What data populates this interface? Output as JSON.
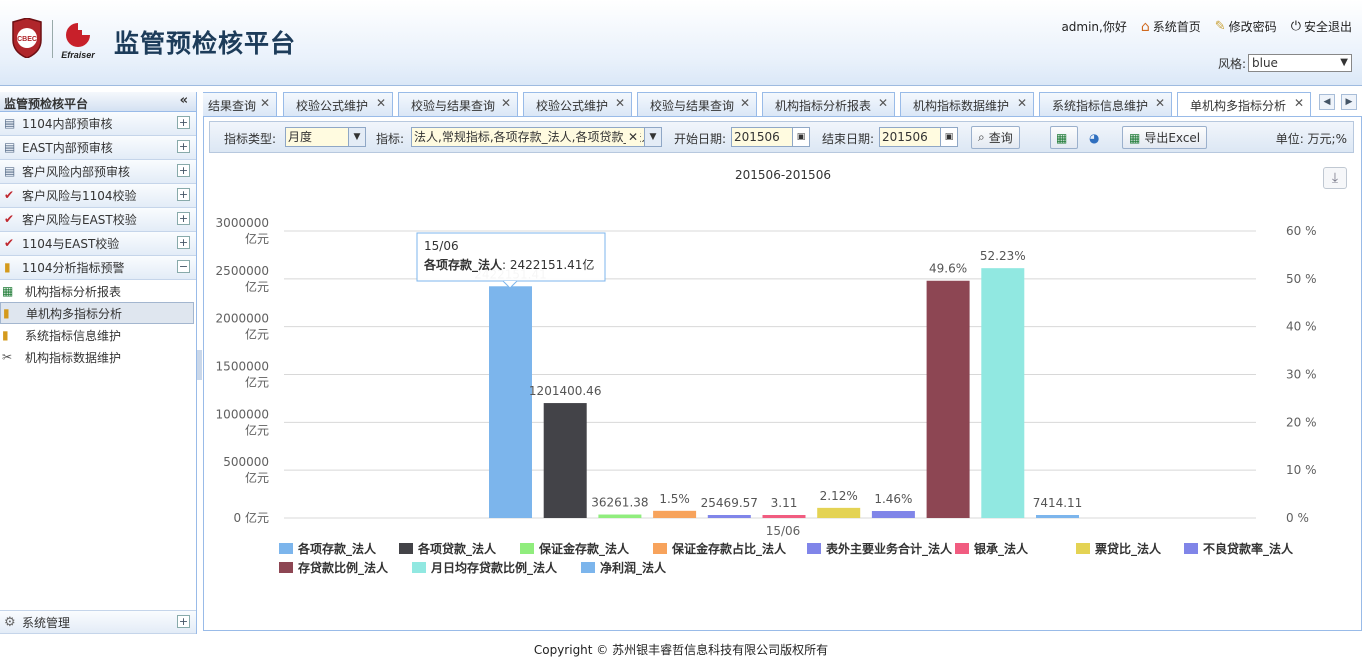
{
  "app": {
    "title": "监管预检核平台",
    "logo1": "CBEC",
    "logo2": "Efraiser"
  },
  "userbar": {
    "greeting": "admin,你好",
    "home": "系统首页",
    "password": "修改密码",
    "logout": "安全退出",
    "style_label": "风格:",
    "style_value": "blue"
  },
  "sidebar": {
    "title": "监管预检核平台",
    "groups": [
      {
        "label": "1104内部预审核",
        "icon": "form-icon"
      },
      {
        "label": "EAST内部预审核",
        "icon": "form-icon"
      },
      {
        "label": "客户风险内部预审核",
        "icon": "form-icon"
      },
      {
        "label": "客户风险与1104校验",
        "icon": "check-icon"
      },
      {
        "label": "客户风险与EAST校验",
        "icon": "check-icon"
      },
      {
        "label": "1104与EAST校验",
        "icon": "check-icon"
      },
      {
        "label": "1104分析指标预警",
        "icon": "bar-chart-icon"
      }
    ],
    "items": [
      {
        "label": "机构指标分析报表",
        "icon": "excel-icon"
      },
      {
        "label": "单机构多指标分析",
        "icon": "bar-chart-icon"
      },
      {
        "label": "系统指标信息维护",
        "icon": "bar-chart-icon"
      },
      {
        "label": "机构指标数据维护",
        "icon": "tools-icon"
      }
    ],
    "system": "系统管理"
  },
  "tabs": [
    "结果查询",
    "校验公式维护",
    "校验与结果查询",
    "校验公式维护",
    "校验与结果查询",
    "机构指标分析报表",
    "机构指标数据维护",
    "系统指标信息维护",
    "单机构多指标分析"
  ],
  "toolbar": {
    "type_label": "指标类型:",
    "type_value": "月度",
    "index_label": "指标:",
    "index_value": "法人,常规指标,各项存款_法人,各项贷款_法人",
    "start_label": "开始日期:",
    "start_value": "201506",
    "end_label": "结束日期:",
    "end_value": "201506",
    "query": "查询",
    "export": "导出Excel",
    "unit": "单位: 万元;%"
  },
  "tooltip": {
    "x": "15/06",
    "series": "各项存款_法人",
    "value": "2422151.41亿"
  },
  "chart_data": {
    "type": "bar",
    "title": "201506-201506",
    "categories": [
      "15/06"
    ],
    "y_left": {
      "min": 0,
      "max": 3000000,
      "ticks": [
        "0 亿元",
        "500000\n亿元",
        "1000000\n亿元",
        "1500000\n亿元",
        "2000000\n亿元",
        "2500000\n亿元",
        "3000000\n亿元"
      ]
    },
    "y_right": {
      "min": 0,
      "max": 60,
      "ticks": [
        "0 %",
        "10 %",
        "20 %",
        "30 %",
        "40 %",
        "50 %",
        "60 %"
      ]
    },
    "grid": true,
    "legend": "bottom-left",
    "series": [
      {
        "name": "各项存款_法人",
        "value": 2422151.41,
        "label": "2422151.41",
        "axis": "left",
        "color": "#7cb5ec"
      },
      {
        "name": "各项贷款_法人",
        "value": 1201400.46,
        "label": "1201400.46",
        "axis": "left",
        "color": "#434348"
      },
      {
        "name": "保证金存款_法人",
        "value": 36261.38,
        "label": "36261.38",
        "axis": "left",
        "color": "#90ed7d"
      },
      {
        "name": "保证金存款占比_法人",
        "value": 1.5,
        "label": "1.5%",
        "axis": "right",
        "color": "#f7a35c"
      },
      {
        "name": "表外主要业务合计_法人",
        "value": 25469.57,
        "label": "25469.57",
        "axis": "left",
        "color": "#8085e9"
      },
      {
        "name": "银承_法人",
        "value": 3.11,
        "label": "3.11",
        "axis": "left",
        "color": "#f15c80"
      },
      {
        "name": "票贷比_法人",
        "value": 2.12,
        "label": "2.12%",
        "axis": "right",
        "color": "#e4d354"
      },
      {
        "name": "不良贷款率_法人",
        "value": 1.46,
        "label": "1.46%",
        "axis": "right",
        "color": "#8085e8"
      },
      {
        "name": "存贷款比例_法人",
        "value": 49.6,
        "label": "49.6%",
        "axis": "right",
        "color": "#8d4653"
      },
      {
        "name": "月日均存贷款比例_法人",
        "value": 52.23,
        "label": "52.23%",
        "axis": "right",
        "color": "#91e8e1"
      },
      {
        "name": "净利润_法人",
        "value": 7414.11,
        "label": "7414.11",
        "axis": "left",
        "color": "#7cb5ec"
      }
    ]
  },
  "footer": "Copyright © 苏州银丰睿哲信息科技有限公司版权所有"
}
